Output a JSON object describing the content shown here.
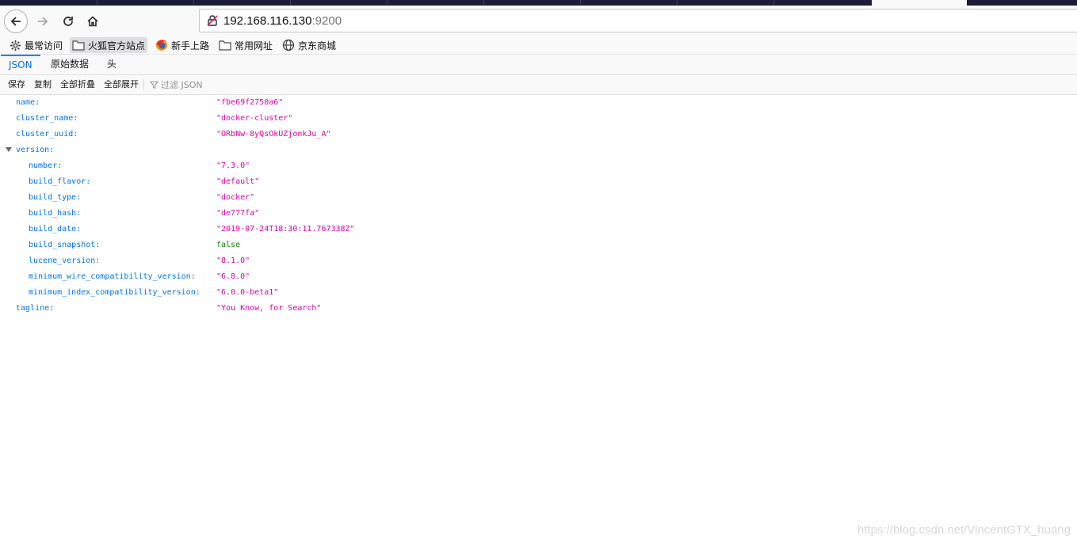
{
  "browser": {
    "url_host": "192.168.116.130",
    "url_port": ":9200"
  },
  "bookmarks": [
    {
      "label": "最常访问",
      "icon": "gear-icon"
    },
    {
      "label": "火狐官方站点",
      "icon": "folder-icon"
    },
    {
      "label": "新手上路",
      "icon": "firefox-icon"
    },
    {
      "label": "常用网址",
      "icon": "folder-icon"
    },
    {
      "label": "京东商城",
      "icon": "globe-icon"
    }
  ],
  "viewer_tabs": [
    {
      "label": "JSON",
      "selected": true
    },
    {
      "label": "原始数据",
      "selected": false
    },
    {
      "label": "头",
      "selected": false
    }
  ],
  "toolbar": {
    "save_label": "保存",
    "copy_label": "复制",
    "collapse_all_label": "全部折叠",
    "expand_all_label": "全部展开",
    "filter_placeholder": "过滤 JSON"
  },
  "json_rows": [
    {
      "key": "name:",
      "value": "\"fbe69f2750a6\"",
      "type": "string",
      "depth": 0
    },
    {
      "key": "cluster_name:",
      "value": "\"docker-cluster\"",
      "type": "string",
      "depth": 0
    },
    {
      "key": "cluster_uuid:",
      "value": "\"ORbNw-8yQsOkUZjonkJu_A\"",
      "type": "string",
      "depth": 0
    },
    {
      "key": "version:",
      "value": "",
      "type": "object",
      "depth": 0
    },
    {
      "key": "number:",
      "value": "\"7.3.0\"",
      "type": "string",
      "depth": 1
    },
    {
      "key": "build_flavor:",
      "value": "\"default\"",
      "type": "string",
      "depth": 1
    },
    {
      "key": "build_type:",
      "value": "\"docker\"",
      "type": "string",
      "depth": 1
    },
    {
      "key": "build_hash:",
      "value": "\"de777fa\"",
      "type": "string",
      "depth": 1
    },
    {
      "key": "build_date:",
      "value": "\"2019-07-24T18:30:11.767338Z\"",
      "type": "string",
      "depth": 1
    },
    {
      "key": "build_snapshot:",
      "value": "false",
      "type": "boolean",
      "depth": 1
    },
    {
      "key": "lucene_version:",
      "value": "\"8.1.0\"",
      "type": "string",
      "depth": 1
    },
    {
      "key": "minimum_wire_compatibility_version:",
      "value": "\"6.8.0\"",
      "type": "string",
      "depth": 1
    },
    {
      "key": "minimum_index_compatibility_version:",
      "value": "\"6.0.0-beta1\"",
      "type": "string",
      "depth": 1
    },
    {
      "key": "tagline:",
      "value": "\"You Know, for Search\"",
      "type": "string",
      "depth": 0
    }
  ],
  "watermark": "https://blog.csdn.net/VincentGTX_huang"
}
